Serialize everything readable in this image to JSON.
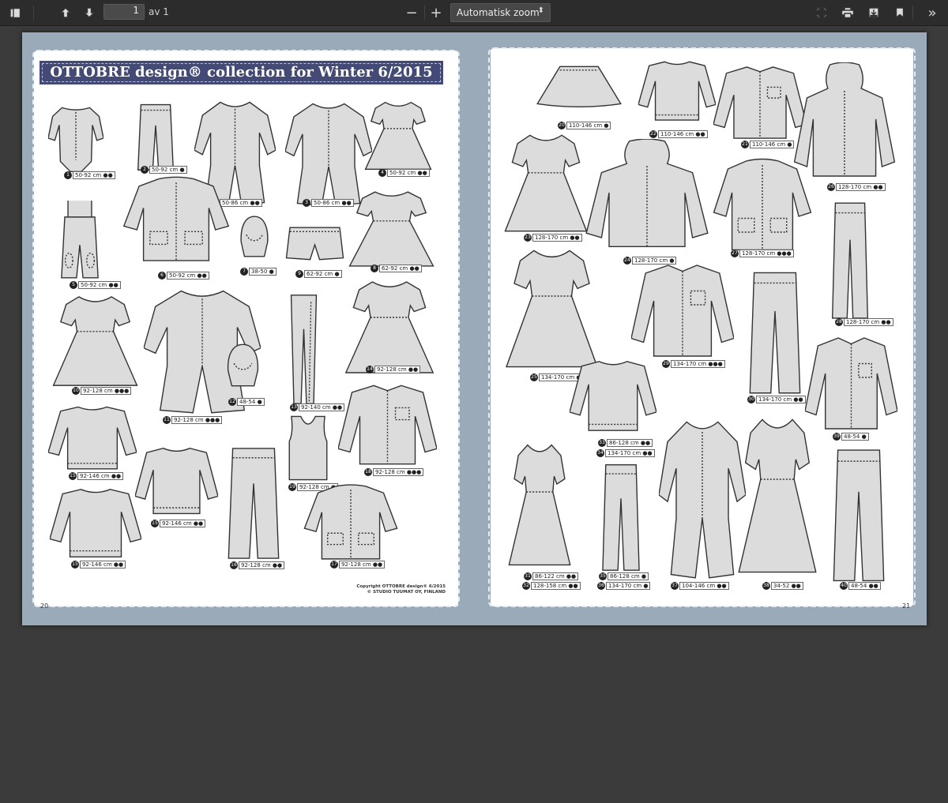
{
  "toolbar": {
    "page_number": "1",
    "page_count": "av 1",
    "zoom_minus": "−",
    "zoom_plus": "+",
    "zoom_value": "Automatisk zoom"
  },
  "document": {
    "title": "OTTOBRE design® collection for Winter 6/2015",
    "left_page_number": "20",
    "right_page_number": "21",
    "copyright_line1": "Copyright OTTOBRE design® 6/2015",
    "copyright_line2": "© STUDIO TUUMAT OY, FINLAND"
  },
  "items": [
    {
      "n": "1",
      "size": "50-92 cm ●●"
    },
    {
      "n": "2",
      "size": "50-92 cm ●"
    },
    {
      "n": "3",
      "size": "50-86 cm ●●"
    },
    {
      "n": "3",
      "size": "50-86 cm ●●"
    },
    {
      "n": "4",
      "size": "50-92 cm ●●"
    },
    {
      "n": "5",
      "size": "50-92 cm ●●"
    },
    {
      "n": "6",
      "size": "50-92 cm ●●"
    },
    {
      "n": "7",
      "size": "38-50 ●"
    },
    {
      "n": "9",
      "size": "62-92 cm ●"
    },
    {
      "n": "8",
      "size": "62-92 cm ●●"
    },
    {
      "n": "10",
      "size": "92-128 cm ●●●"
    },
    {
      "n": "11",
      "size": "92-128 cm ●●●"
    },
    {
      "n": "12",
      "size": "48-54 ●"
    },
    {
      "n": "13",
      "size": "92-140 cm ●●"
    },
    {
      "n": "14",
      "size": "92-128 cm ●●"
    },
    {
      "n": "15",
      "size": "92-146 cm ●●"
    },
    {
      "n": "15",
      "size": "92-146 cm ●●"
    },
    {
      "n": "15",
      "size": "92-146 cm ●●"
    },
    {
      "n": "16",
      "size": "92-128 cm ●●"
    },
    {
      "n": "19",
      "size": "92-128 cm ●"
    },
    {
      "n": "18",
      "size": "92-128 cm ●●●"
    },
    {
      "n": "17",
      "size": "92-128 cm ●●"
    },
    {
      "n": "20",
      "size": "110-146 cm ●"
    },
    {
      "n": "22",
      "size": "110-146 cm ●●"
    },
    {
      "n": "21",
      "size": "110-146 cm ●"
    },
    {
      "n": "26",
      "size": "128-170 cm ●●"
    },
    {
      "n": "23",
      "size": "128-170 cm ●●"
    },
    {
      "n": "24",
      "size": "128-170 cm ●"
    },
    {
      "n": "27",
      "size": "128-170 cm ●●●"
    },
    {
      "n": "28",
      "size": "128-170 cm ●●"
    },
    {
      "n": "25",
      "size": "134-170 cm ●●"
    },
    {
      "n": "29",
      "size": "134-170 cm ●●●"
    },
    {
      "n": "30",
      "size": "134-170 cm ●●"
    },
    {
      "n": "33",
      "size": "86-128 cm ●●"
    },
    {
      "n": "34",
      "size": "134-170 cm ●●"
    },
    {
      "n": "39",
      "size": "48-54 ●"
    },
    {
      "n": "31",
      "size": "86-122 cm ●●"
    },
    {
      "n": "32",
      "size": "128-158 cm ●●"
    },
    {
      "n": "35",
      "size": "86-128 cm ●"
    },
    {
      "n": "36",
      "size": "134-170 cm ●"
    },
    {
      "n": "37",
      "size": "104-146 cm ●●"
    },
    {
      "n": "38",
      "size": "34-52 ●●"
    },
    {
      "n": "40",
      "size": "48-54 ●●"
    }
  ]
}
